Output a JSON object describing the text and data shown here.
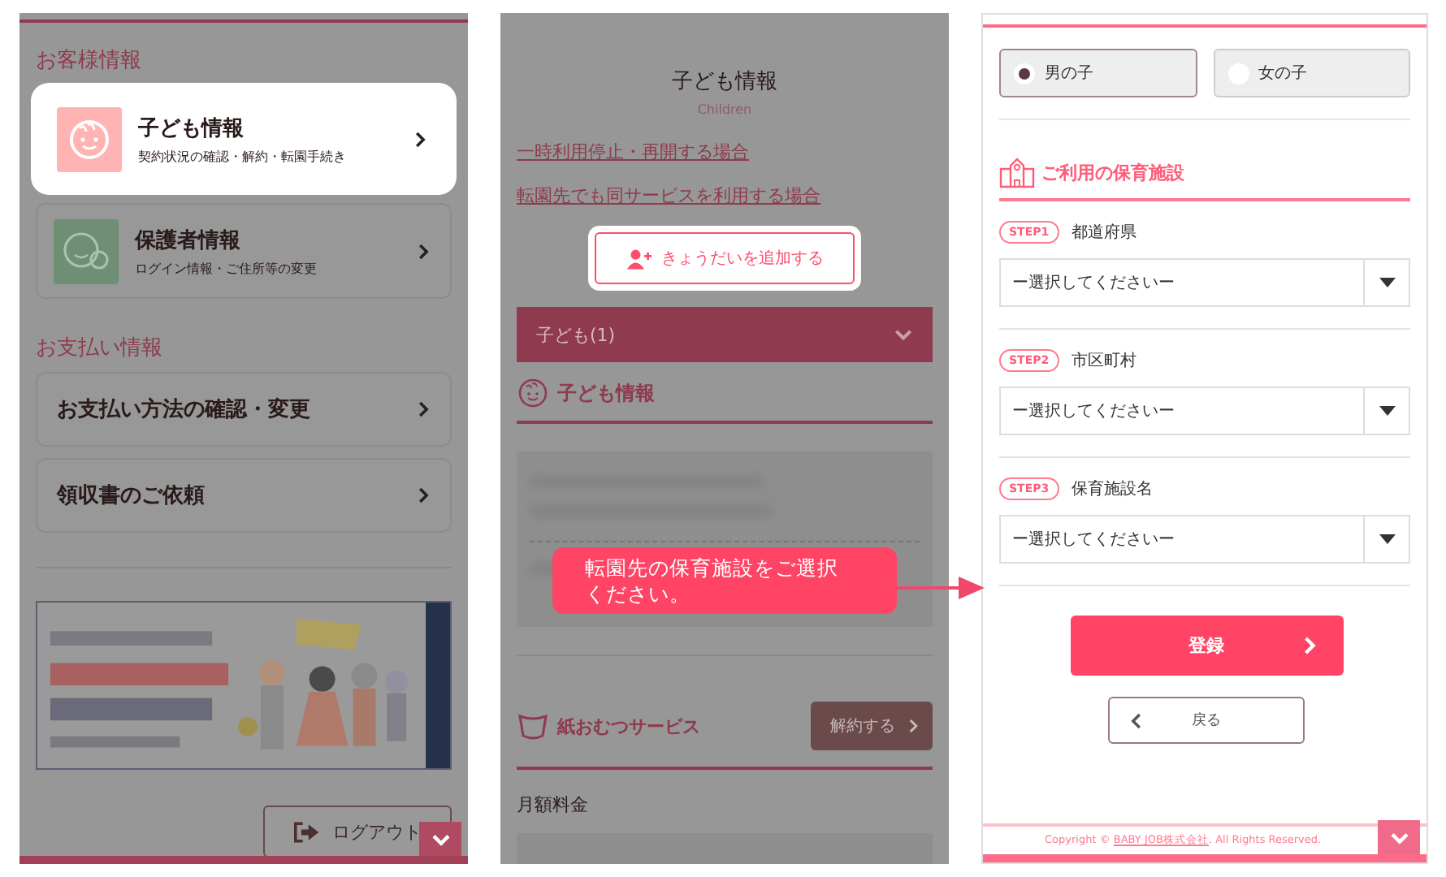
{
  "menu_screen": {
    "sections": [
      {
        "title": "お客様情報",
        "items": [
          {
            "title": "子ども情報",
            "subtitle": "契約状況の確認・解約・転園手続き",
            "kind": "child",
            "highlighted": true
          },
          {
            "title": "保護者情報",
            "subtitle": "ログイン情報・ご住所等の変更",
            "kind": "parent",
            "highlighted": false
          }
        ]
      },
      {
        "title": "お支払い情報",
        "items": [
          {
            "title": "お支払い方法の確認・変更",
            "highlighted": false
          },
          {
            "title": "領収書のご依頼",
            "highlighted": false
          }
        ]
      }
    ],
    "logout_button": "ログアウト"
  },
  "children_screen": {
    "title": "子ども情報",
    "subtitle": "Children",
    "links": [
      "一時利用停止・再開する場合",
      "転園先でも同サービスを利用する場合"
    ],
    "add_button": {
      "label": "きょうだいを追加する",
      "highlighted": true
    },
    "accordion": "子ども(1)",
    "section_title": "子ども情報",
    "service": {
      "title": "紙おむつサービス",
      "button": "解約する"
    },
    "fee_label": "月額料金"
  },
  "facility_screen": {
    "gender_options": [
      {
        "label": "男の子",
        "selected": true
      },
      {
        "label": "女の子",
        "selected": false
      }
    ],
    "section_title": "ご利用の保育施設",
    "steps": [
      {
        "badge": "STEP1",
        "label": "都道府県",
        "placeholder": "ー選択してくださいー"
      },
      {
        "badge": "STEP2",
        "label": "市区町村",
        "placeholder": "ー選択してくださいー"
      },
      {
        "badge": "STEP3",
        "label": "保育施設名",
        "placeholder": "ー選択してくださいー"
      }
    ],
    "submit_button": "登録",
    "back_button": "戻る",
    "copyright": {
      "prefix": "Copyright © ",
      "company": "BABY JOB株式会社",
      "suffix": ". All Rights Reserved."
    }
  },
  "callout": "転園先の保育施設をご選択ください。"
}
